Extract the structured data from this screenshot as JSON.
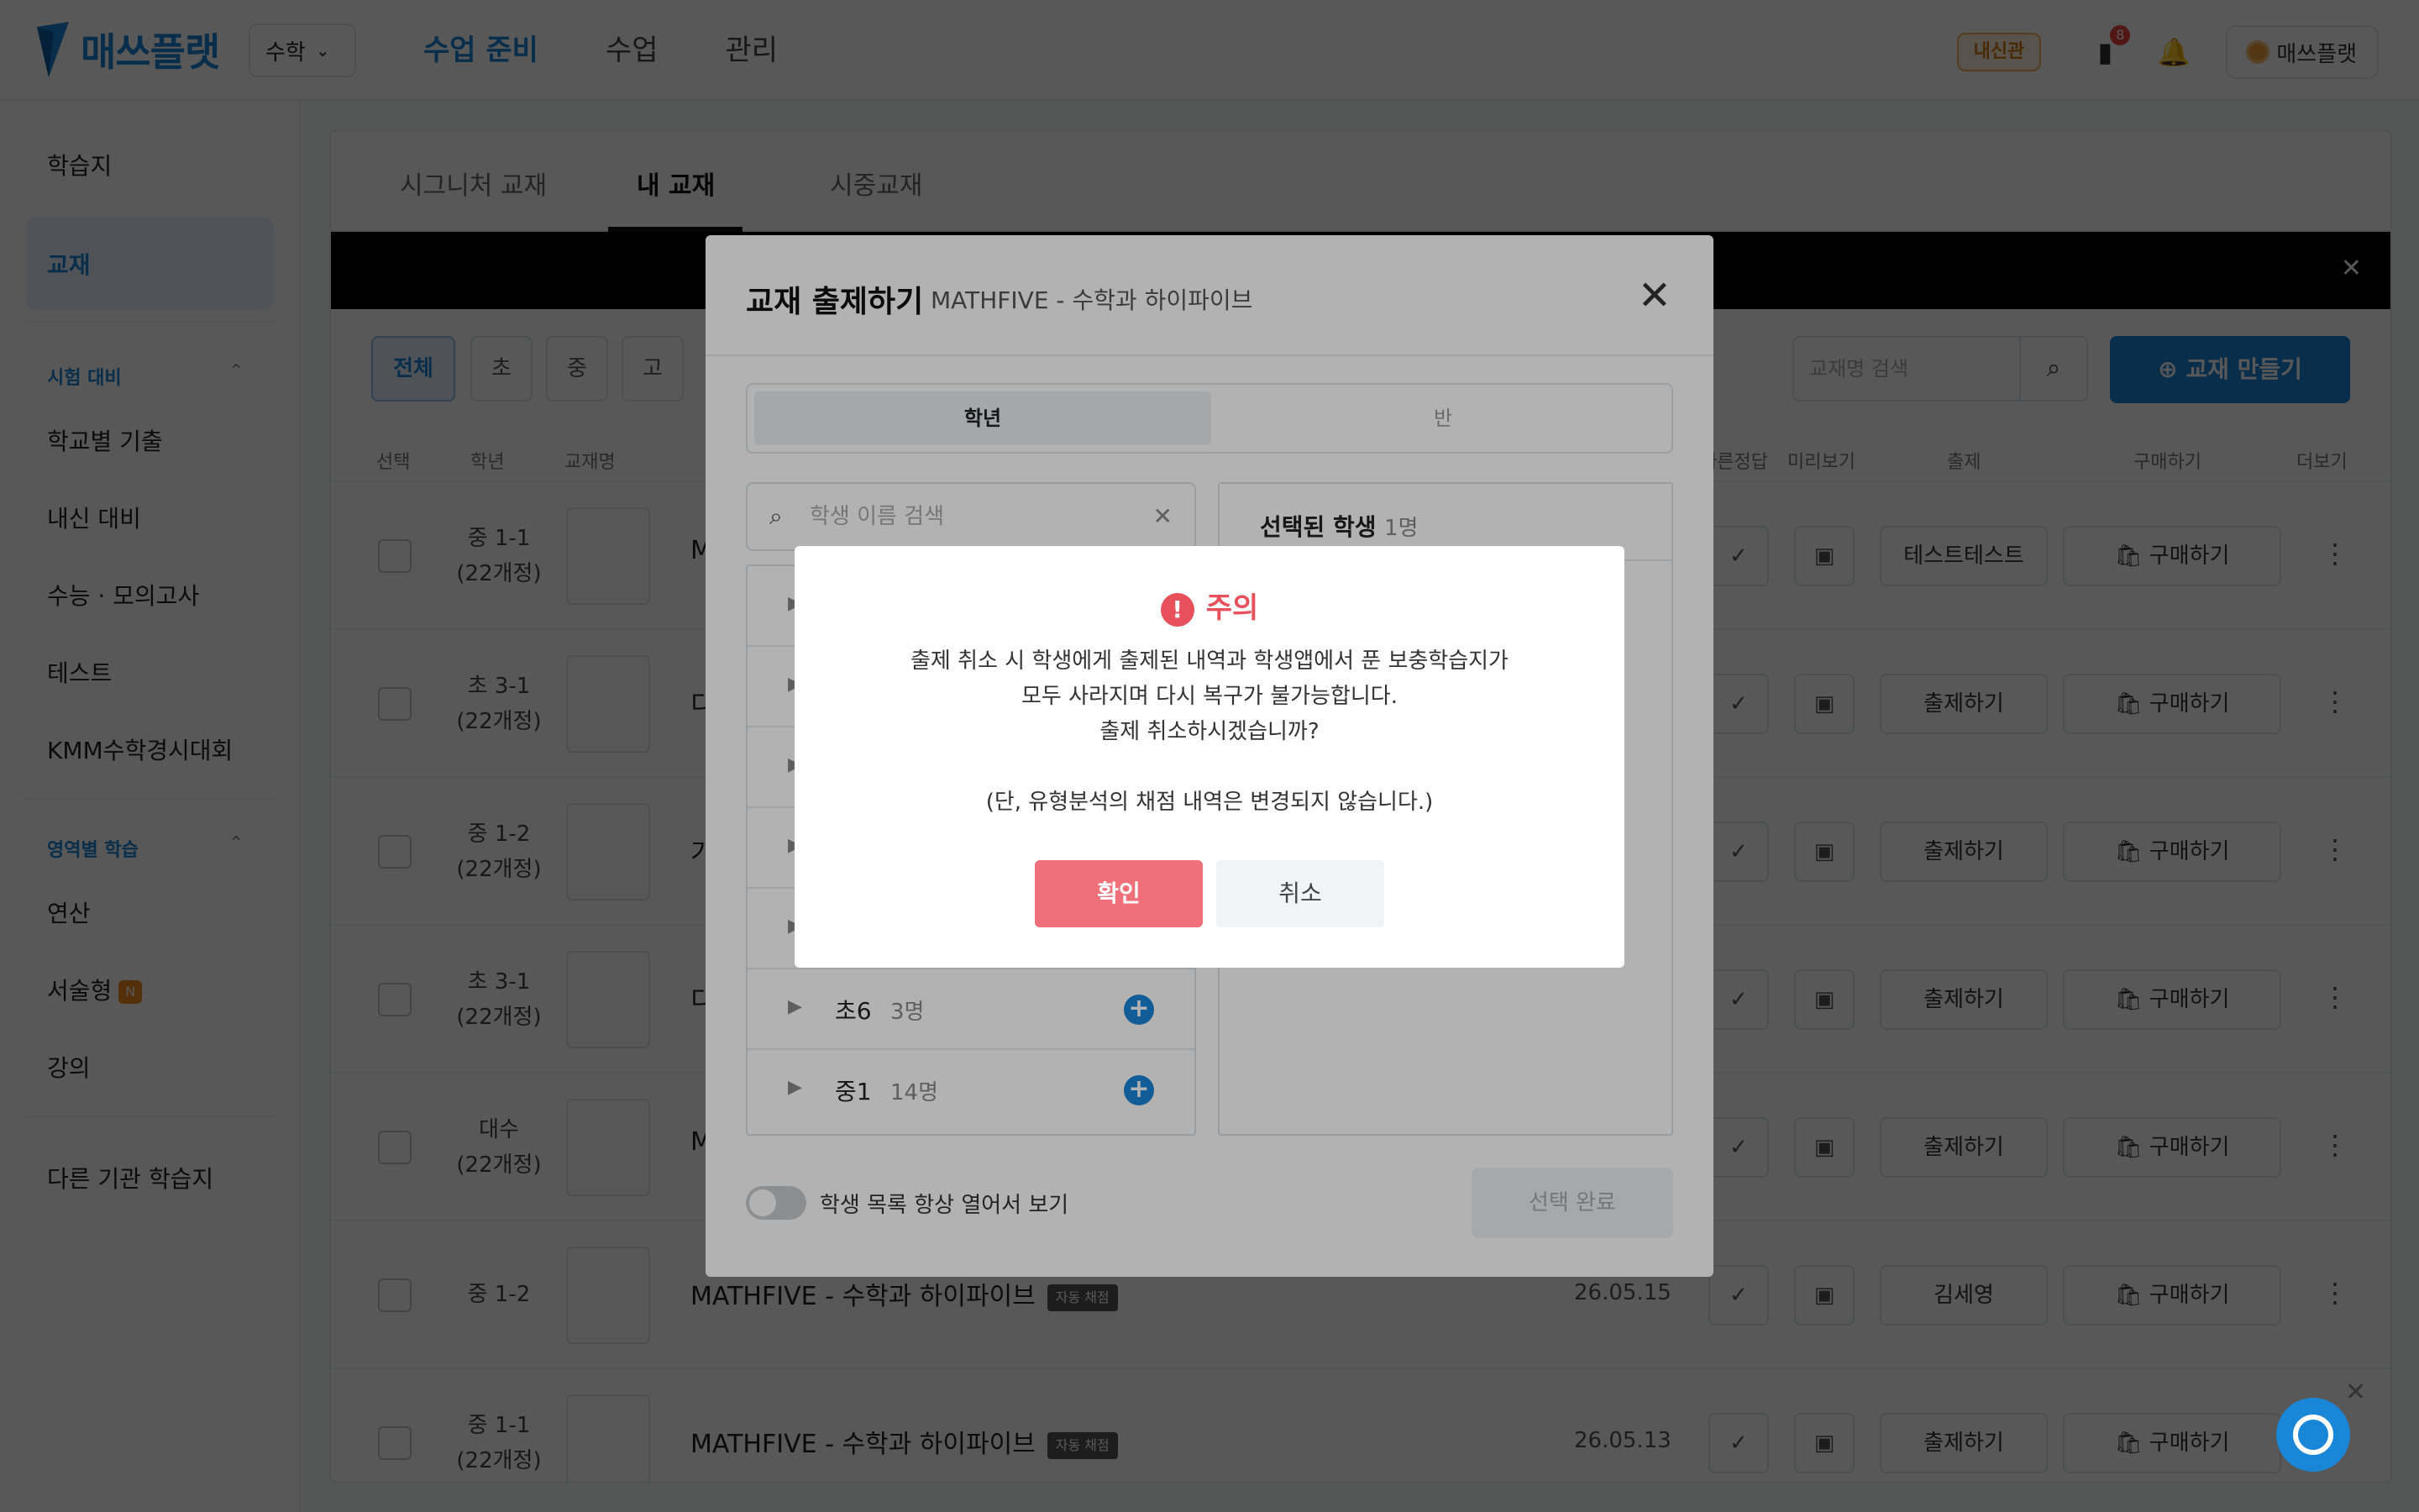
{
  "header": {
    "logo_text": "매쓰플랫",
    "subject": "수학",
    "nav": [
      "수업 준비",
      "수업",
      "관리"
    ],
    "badge": "내신관",
    "notif_count": "8",
    "user": "매쓰플랫"
  },
  "sidebar": {
    "item_worksheet": "학습지",
    "item_textbook": "교재",
    "section_exam": "시험 대비",
    "exam_items": [
      "학교별 기출",
      "내신 대비",
      "수능 · 모의고사",
      "테스트",
      "KMM수학경시대회"
    ],
    "section_area": "영역별 학습",
    "area_items": [
      "연산",
      "서술형",
      "강의"
    ],
    "new_badge": "N",
    "other_org": "다른 기관 학습지"
  },
  "main": {
    "tabs": [
      "시그니처 교재",
      "내 교재",
      "시중교재"
    ],
    "filters": [
      "전체",
      "초",
      "중",
      "고"
    ],
    "search_placeholder": "교재명 검색",
    "make_button": "교재 만들기",
    "columns": [
      "선택",
      "학년",
      "교재명",
      "빠른정답",
      "미리보기",
      "출제",
      "구매하기",
      "더보기"
    ],
    "rows": [
      {
        "grade1": "중 1-1",
        "grade2": "(22개정)",
        "title": "M",
        "tag": "",
        "date": "",
        "assign": "테스트테스트",
        "buy": "구매하기"
      },
      {
        "grade1": "초 3-1",
        "grade2": "(22개정)",
        "title": "디",
        "tag": "",
        "date": "",
        "assign": "출제하기",
        "buy": "구매하기"
      },
      {
        "grade1": "중 1-2",
        "grade2": "(22개정)",
        "title": "기",
        "tag": "",
        "date": "",
        "assign": "출제하기",
        "buy": "구매하기"
      },
      {
        "grade1": "초 3-1",
        "grade2": "(22개정)",
        "title": "디",
        "tag": "",
        "date": "",
        "assign": "출제하기",
        "buy": "구매하기"
      },
      {
        "grade1": "대수",
        "grade2": "(22개정)",
        "title": "M",
        "tag": "",
        "date": "",
        "assign": "출제하기",
        "buy": "구매하기"
      },
      {
        "grade1": "중 1-2",
        "grade2": "",
        "title": "MATHFIVE - 수학과 하이파이브",
        "tag": "자동 채점",
        "date": "26.05.15",
        "assign": "김세영",
        "buy": "구매하기"
      },
      {
        "grade1": "중 1-1",
        "grade2": "(22개정)",
        "title": "MATHFIVE - 수학과 하이파이브",
        "tag": "자동 채점",
        "date": "26.05.13",
        "assign": "출제하기",
        "buy": "구매하기"
      }
    ]
  },
  "modal": {
    "title": "교재 출제하기",
    "subtitle": "MATHFIVE - 수학과 하이파이브",
    "seg_grade": "학년",
    "seg_class": "반",
    "search_placeholder": "학생 이름 검색",
    "groups": [
      {
        "name": "초6",
        "count": "3명"
      },
      {
        "name": "중1",
        "count": "14명"
      }
    ],
    "selected_title": "선택된 학생",
    "selected_count": "1명",
    "toggle_label": "학생 목록 항상 열어서 보기",
    "done": "선택 완료"
  },
  "alert": {
    "title": "주의",
    "lines": [
      "출제 취소 시 학생에게 출제된 내역과 학생앱에서 푼 보충학습지가",
      "모두 사라지며 다시 복구가 불가능합니다.",
      "출제 취소하시겠습니까?",
      "(단, 유형분석의 채점 내역은 변경되지 않습니다.)"
    ],
    "confirm": "확인",
    "cancel": "취소"
  },
  "colors": {
    "brand": "#1a86d8",
    "warning": "#e8505b",
    "confirm": "#f0707a"
  }
}
